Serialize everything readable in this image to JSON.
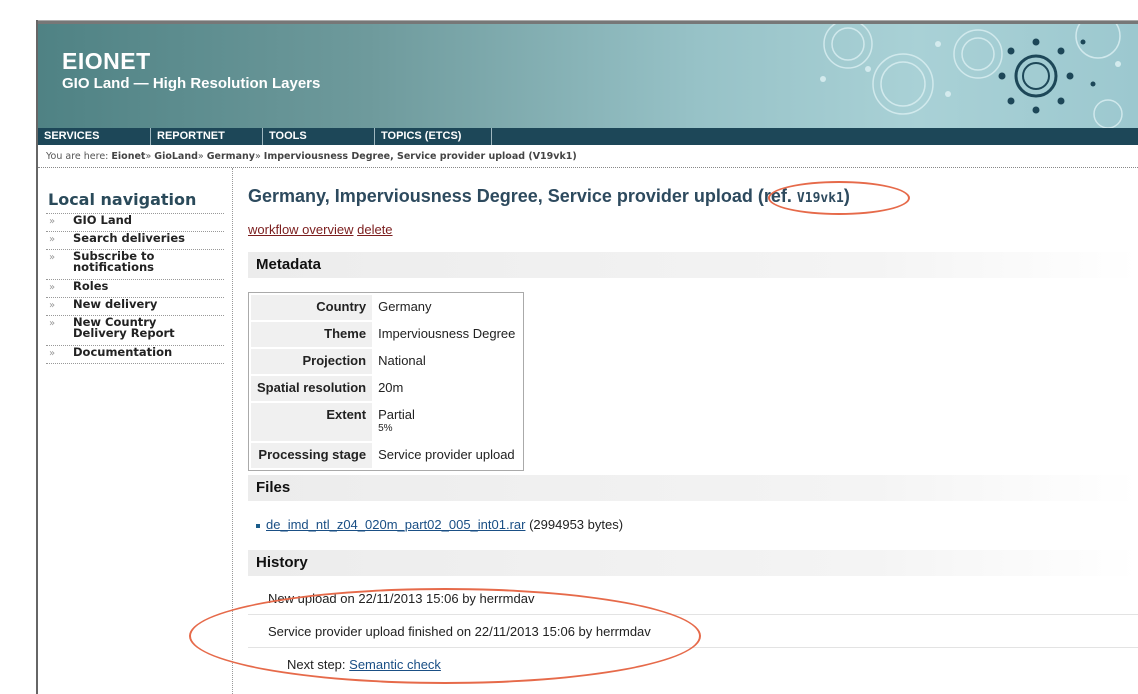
{
  "header": {
    "brand": "EIONET",
    "subtitle": "GIO Land — High Resolution Layers"
  },
  "menu": [
    "SERVICES",
    "REPORTNET",
    "TOOLS",
    "TOPICS (ETCS)"
  ],
  "breadcrumb": {
    "prefix": "You are here:",
    "items": [
      "Eionet",
      "GioLand",
      "Germany",
      "Imperviousness Degree, Service provider upload (V19vk1)"
    ],
    "separator": "»"
  },
  "sidebar": {
    "title": "Local navigation",
    "items": [
      {
        "label": "GIO Land"
      },
      {
        "label": "Search deliveries"
      },
      {
        "label": "Subscribe to notifications"
      },
      {
        "label": "Roles"
      },
      {
        "label": "New delivery"
      },
      {
        "label": "New Country Delivery Report"
      },
      {
        "label": "Documentation"
      }
    ]
  },
  "page": {
    "title": "Germany, Imperviousness Degree, Service provider upload",
    "ref_prefix": "(ref.",
    "ref_code": "V19vk1",
    "ref_suffix": ")",
    "actions": {
      "workflow": "workflow overview",
      "delete": "delete"
    }
  },
  "metadata": {
    "heading": "Metadata",
    "rows": [
      {
        "label": "Country",
        "value": "Germany"
      },
      {
        "label": "Theme",
        "value": "Imperviousness Degree"
      },
      {
        "label": "Projection",
        "value": "National"
      },
      {
        "label": "Spatial resolution",
        "value": "20m"
      },
      {
        "label": "Extent",
        "value": "Partial",
        "sub": "5%"
      },
      {
        "label": "Processing stage",
        "value": "Service provider upload"
      }
    ]
  },
  "files": {
    "heading": "Files",
    "items": [
      {
        "name": "de_imd_ntl_z04_020m_part02_005_int01.rar",
        "size": "(2994953 bytes)"
      }
    ]
  },
  "history": {
    "heading": "History",
    "entries": [
      "New upload on 22/11/2013 15:06 by herrmdav",
      "Service provider upload finished on 22/11/2013 15:06 by herrmdav"
    ],
    "next_step_label": "Next step:",
    "next_step_link": "Semantic check"
  },
  "colors": {
    "header_dark": "#4f8284",
    "header_light": "#a9d1d6",
    "menubar": "#1d4758",
    "link": "#1a4f85",
    "annotation": "#e66a4a"
  }
}
